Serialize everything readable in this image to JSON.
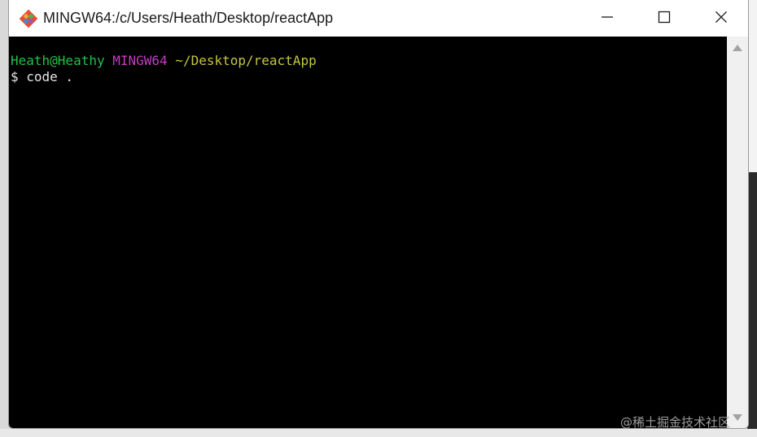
{
  "window": {
    "title": "MINGW64:/c/Users/Heath/Desktop/reactApp",
    "app_icon": "git-diamond-icon",
    "controls": {
      "minimize_icon": "minimize-icon",
      "maximize_icon": "maximize-icon",
      "close_icon": "close-icon"
    }
  },
  "terminal": {
    "prompt": {
      "user_host": "Heath@Heathy",
      "system": "MINGW64",
      "path": "~/Desktop/reactApp"
    },
    "command_line": "$ code ."
  },
  "colors": {
    "terminal_bg": "#000000",
    "user_host": "#23c14b",
    "system": "#c43cc4",
    "path": "#c6c640",
    "text": "#e6e6e6"
  },
  "watermark": "@稀土掘金技术社区"
}
